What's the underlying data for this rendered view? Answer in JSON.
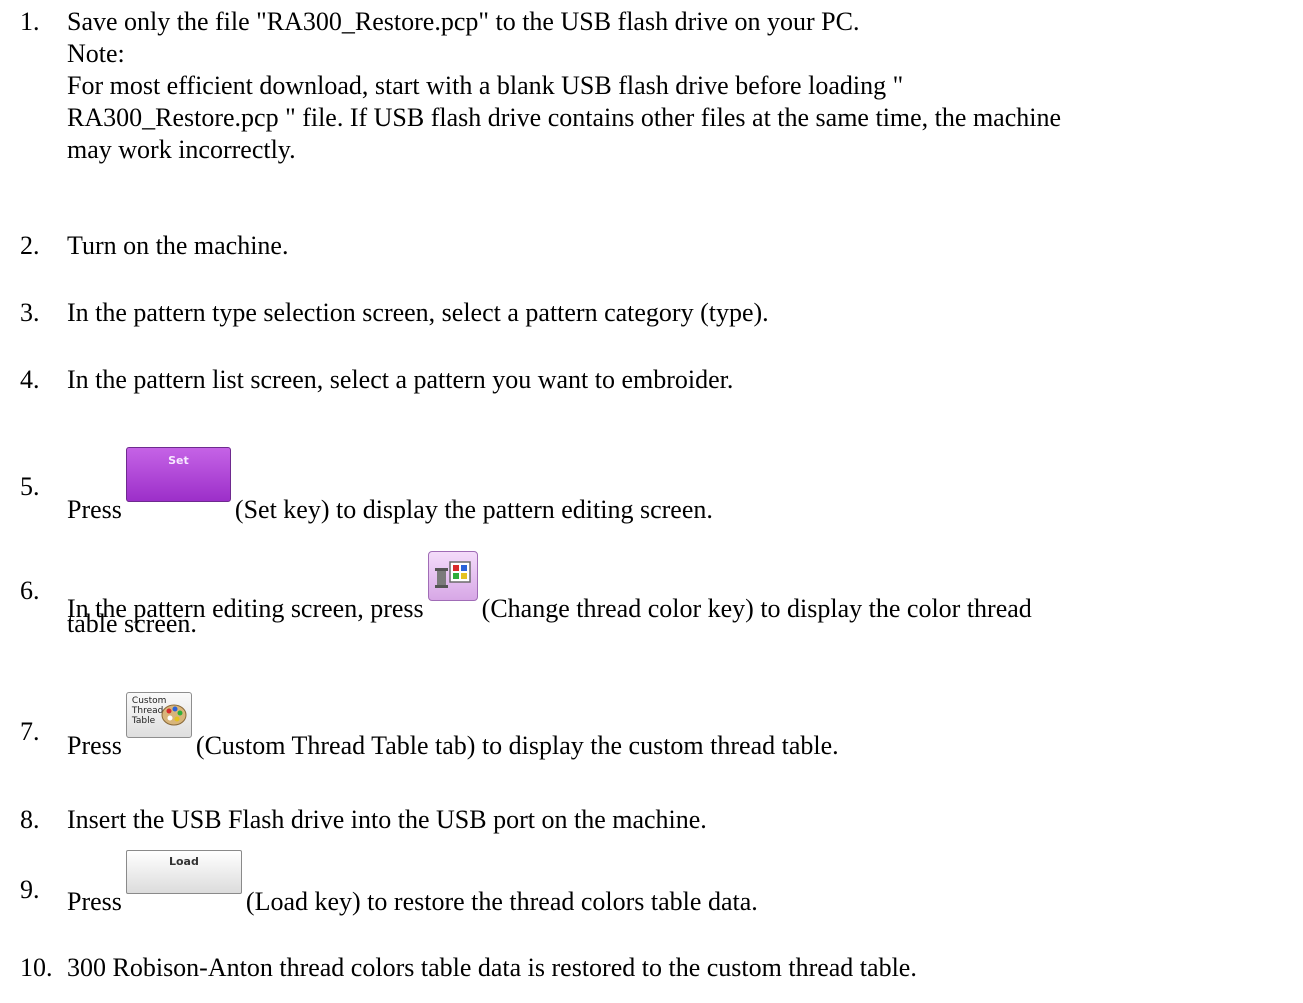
{
  "steps": [
    {
      "num": "1.",
      "lines": [
        "Save only the file \"RA300_Restore.pcp\" to the USB flash drive on your PC.",
        "Note:",
        "For most efficient download, start with a blank USB flash drive before loading \"",
        "RA300_Restore.pcp \" file. If USB flash drive contains other files at the same time, the machine",
        "may work incorrectly."
      ]
    },
    {
      "num": "2.",
      "text": "Turn on the machine."
    },
    {
      "num": "3.",
      "text": "In the pattern type selection screen, select a pattern category (type)."
    },
    {
      "num": "4.",
      "text": "In the pattern list screen, select a pattern you want to embroider."
    },
    {
      "num": "5.",
      "before": "Press",
      "key_label": "Set",
      "key_icon": "set-key-icon",
      "after": "(Set key) to display the pattern editing screen."
    },
    {
      "num": "6.",
      "before": "In the pattern editing screen, press",
      "key_icon": "change-thread-color-key-icon",
      "after": "(Change thread color key) to display the color thread",
      "continuation": "table screen."
    },
    {
      "num": "7.",
      "before": "Press",
      "key_label": "Custom Thread Table",
      "key_icon": "custom-thread-table-tab-icon",
      "after": "(Custom Thread Table tab) to display the custom thread table."
    },
    {
      "num": "8.",
      "text": "Insert the USB Flash drive into the USB port on the machine."
    },
    {
      "num": "9.",
      "before": "Press",
      "key_label": "Load",
      "key_icon": "load-key-icon",
      "after": "(Load key) to restore the thread colors table data."
    },
    {
      "num": "10.",
      "text": "300 Robison-Anton thread colors table data is restored to the custom thread table."
    }
  ],
  "colors": {
    "set_key": "#b047d9",
    "thread_key": "#e7c3f1",
    "text": "#000000"
  }
}
